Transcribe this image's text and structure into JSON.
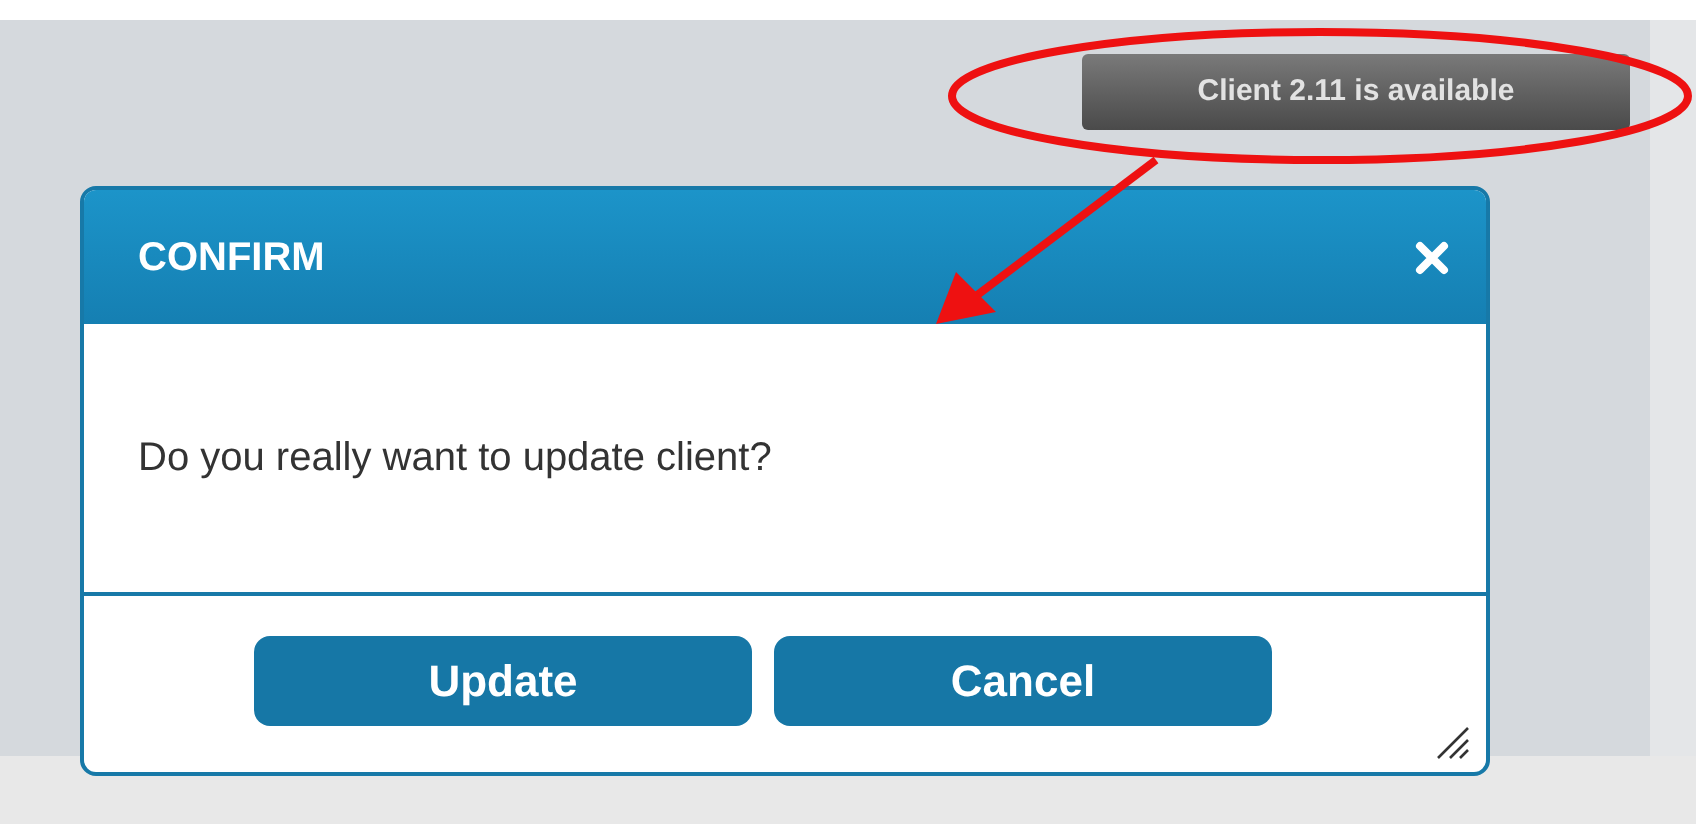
{
  "notification": {
    "label": "Client 2.11 is available"
  },
  "dialog": {
    "title": "CONFIRM",
    "message": "Do you really want to update client?",
    "buttons": [
      "Update",
      "Cancel"
    ]
  }
}
